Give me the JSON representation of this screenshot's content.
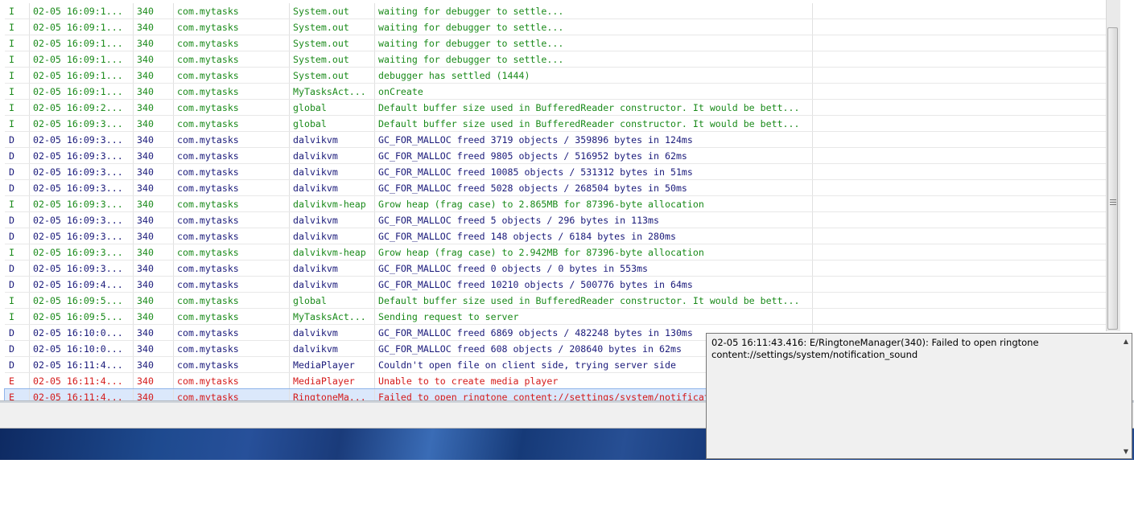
{
  "logcat": {
    "rows": [
      {
        "level": "I",
        "time": "02-05 16:09:1...",
        "pid": "340",
        "app": "com.mytasks",
        "tag": "System.out",
        "text": "waiting for debugger to settle..."
      },
      {
        "level": "I",
        "time": "02-05 16:09:1...",
        "pid": "340",
        "app": "com.mytasks",
        "tag": "System.out",
        "text": "waiting for debugger to settle..."
      },
      {
        "level": "I",
        "time": "02-05 16:09:1...",
        "pid": "340",
        "app": "com.mytasks",
        "tag": "System.out",
        "text": "waiting for debugger to settle..."
      },
      {
        "level": "I",
        "time": "02-05 16:09:1...",
        "pid": "340",
        "app": "com.mytasks",
        "tag": "System.out",
        "text": "waiting for debugger to settle..."
      },
      {
        "level": "I",
        "time": "02-05 16:09:1...",
        "pid": "340",
        "app": "com.mytasks",
        "tag": "System.out",
        "text": "debugger has settled (1444)"
      },
      {
        "level": "I",
        "time": "02-05 16:09:1...",
        "pid": "340",
        "app": "com.mytasks",
        "tag": "MyTasksAct...",
        "text": "onCreate"
      },
      {
        "level": "I",
        "time": "02-05 16:09:2...",
        "pid": "340",
        "app": "com.mytasks",
        "tag": "global",
        "text": "Default buffer size used in BufferedReader constructor. It would be bett..."
      },
      {
        "level": "I",
        "time": "02-05 16:09:3...",
        "pid": "340",
        "app": "com.mytasks",
        "tag": "global",
        "text": "Default buffer size used in BufferedReader constructor. It would be bett..."
      },
      {
        "level": "D",
        "time": "02-05 16:09:3...",
        "pid": "340",
        "app": "com.mytasks",
        "tag": "dalvikvm",
        "text": "GC_FOR_MALLOC freed 3719 objects / 359896 bytes in 124ms"
      },
      {
        "level": "D",
        "time": "02-05 16:09:3...",
        "pid": "340",
        "app": "com.mytasks",
        "tag": "dalvikvm",
        "text": "GC_FOR_MALLOC freed 9805 objects / 516952 bytes in 62ms"
      },
      {
        "level": "D",
        "time": "02-05 16:09:3...",
        "pid": "340",
        "app": "com.mytasks",
        "tag": "dalvikvm",
        "text": "GC_FOR_MALLOC freed 10085 objects / 531312 bytes in 51ms"
      },
      {
        "level": "D",
        "time": "02-05 16:09:3...",
        "pid": "340",
        "app": "com.mytasks",
        "tag": "dalvikvm",
        "text": "GC_FOR_MALLOC freed 5028 objects / 268504 bytes in 50ms"
      },
      {
        "level": "I",
        "time": "02-05 16:09:3...",
        "pid": "340",
        "app": "com.mytasks",
        "tag": "dalvikvm-heap",
        "text": "Grow heap (frag case) to 2.865MB for 87396-byte allocation"
      },
      {
        "level": "D",
        "time": "02-05 16:09:3...",
        "pid": "340",
        "app": "com.mytasks",
        "tag": "dalvikvm",
        "text": "GC_FOR_MALLOC freed 5 objects / 296 bytes in 113ms"
      },
      {
        "level": "D",
        "time": "02-05 16:09:3...",
        "pid": "340",
        "app": "com.mytasks",
        "tag": "dalvikvm",
        "text": "GC_FOR_MALLOC freed 148 objects / 6184 bytes in 280ms"
      },
      {
        "level": "I",
        "time": "02-05 16:09:3...",
        "pid": "340",
        "app": "com.mytasks",
        "tag": "dalvikvm-heap",
        "text": "Grow heap (frag case) to 2.942MB for 87396-byte allocation"
      },
      {
        "level": "D",
        "time": "02-05 16:09:3...",
        "pid": "340",
        "app": "com.mytasks",
        "tag": "dalvikvm",
        "text": "GC_FOR_MALLOC freed 0 objects / 0 bytes in 553ms"
      },
      {
        "level": "D",
        "time": "02-05 16:09:4...",
        "pid": "340",
        "app": "com.mytasks",
        "tag": "dalvikvm",
        "text": "GC_FOR_MALLOC freed 10210 objects / 500776 bytes in 64ms"
      },
      {
        "level": "I",
        "time": "02-05 16:09:5...",
        "pid": "340",
        "app": "com.mytasks",
        "tag": "global",
        "text": "Default buffer size used in BufferedReader constructor. It would be bett..."
      },
      {
        "level": "I",
        "time": "02-05 16:09:5...",
        "pid": "340",
        "app": "com.mytasks",
        "tag": "MyTasksAct...",
        "text": "Sending request to server"
      },
      {
        "level": "D",
        "time": "02-05 16:10:0...",
        "pid": "340",
        "app": "com.mytasks",
        "tag": "dalvikvm",
        "text": "GC_FOR_MALLOC freed 6869 objects / 482248 bytes in 130ms"
      },
      {
        "level": "D",
        "time": "02-05 16:10:0...",
        "pid": "340",
        "app": "com.mytasks",
        "tag": "dalvikvm",
        "text": "GC_FOR_MALLOC freed 608 objects / 208640 bytes in 62ms"
      },
      {
        "level": "D",
        "time": "02-05 16:11:4...",
        "pid": "340",
        "app": "com.mytasks",
        "tag": "MediaPlayer",
        "text": "Couldn't open file on client side, trying server side"
      },
      {
        "level": "E",
        "time": "02-05 16:11:4...",
        "pid": "340",
        "app": "com.mytasks",
        "tag": "MediaPlayer",
        "text": "Unable to to create media player"
      },
      {
        "level": "E",
        "time": "02-05 16:11:4...",
        "pid": "340",
        "app": "com.mytasks",
        "tag": "RingtoneMa...",
        "text": "Failed to open ringtone content://settings/system/notification_sound",
        "selected": true
      }
    ]
  },
  "tooltip": {
    "text": "02-05 16:11:43.416: E/RingtoneManager(340): Failed to open ringtone\ncontent://settings/system/notification_sound"
  },
  "colors": {
    "info": "#1a8a1a",
    "debug": "#1a1a7a",
    "error": "#d41a1a",
    "selection": "#dbe8fb"
  },
  "icons": {
    "scroll_up": "chevron-up-icon",
    "scroll_down": "chevron-down-icon",
    "scroll_grip": "grip-icon"
  }
}
